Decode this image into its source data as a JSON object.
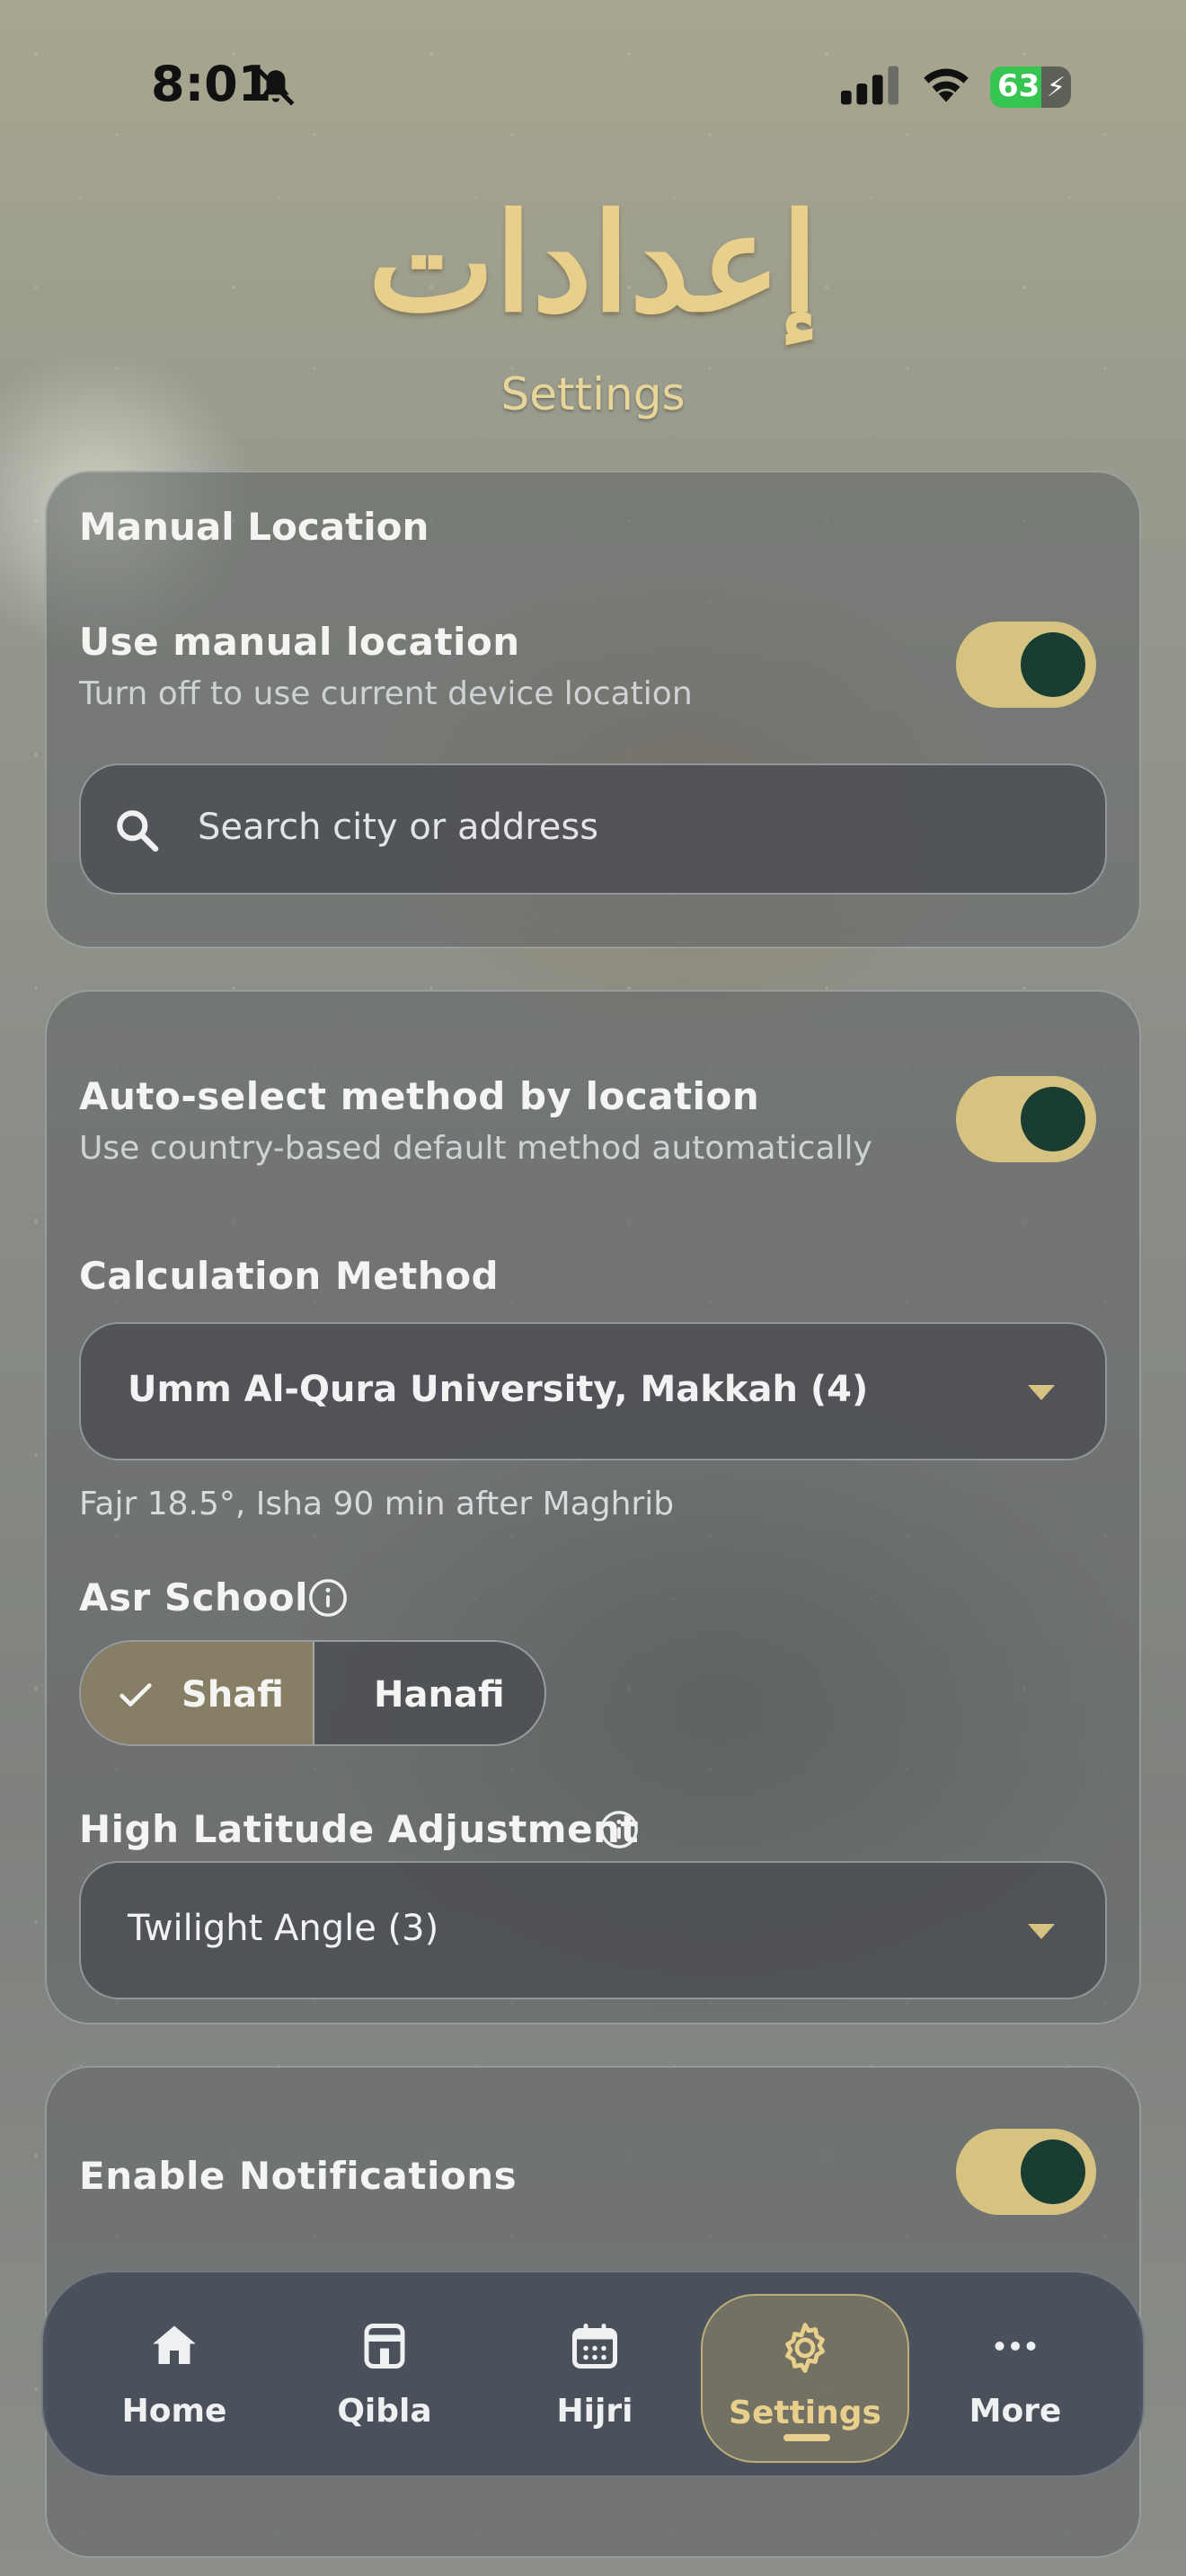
{
  "status_bar": {
    "time": "8:01",
    "battery": "63"
  },
  "header": {
    "arabic_title": "إعدادات",
    "subtitle": "Settings"
  },
  "manual_location": {
    "title": "Manual Location",
    "toggle_label": "Use manual location",
    "toggle_sub": "Turn off to use current device location",
    "toggle_on": true,
    "search_placeholder": "Search city or address"
  },
  "calculation": {
    "auto_label": "Auto-select method by location",
    "auto_sub": "Use country-based default method automatically",
    "auto_on": true,
    "method_title": "Calculation Method",
    "method_value": "Umm Al-Qura University, Makkah (4)",
    "method_hint": "Fajr 18.5°, Isha 90 min after Maghrib",
    "asr_title": "Asr School",
    "asr_options": [
      "Shafi",
      "Hanafi"
    ],
    "asr_selected": "Shafi",
    "high_lat_title": "High Latitude Adjustment",
    "high_lat_value": "Twilight Angle (3)"
  },
  "notifications": {
    "label": "Enable Notifications",
    "enabled": true
  },
  "tabbar": {
    "tabs": [
      {
        "label": "Home",
        "icon": "home-icon"
      },
      {
        "label": "Qibla",
        "icon": "kaaba-icon"
      },
      {
        "label": "Hijri",
        "icon": "calendar-icon"
      },
      {
        "label": "Settings",
        "icon": "gear-icon"
      },
      {
        "label": "More",
        "icon": "more-dots-icon"
      }
    ],
    "active": "Settings"
  },
  "colors": {
    "accent_gold": "#d6c281",
    "knob_green": "#193d33",
    "battery_green": "#37c552"
  }
}
